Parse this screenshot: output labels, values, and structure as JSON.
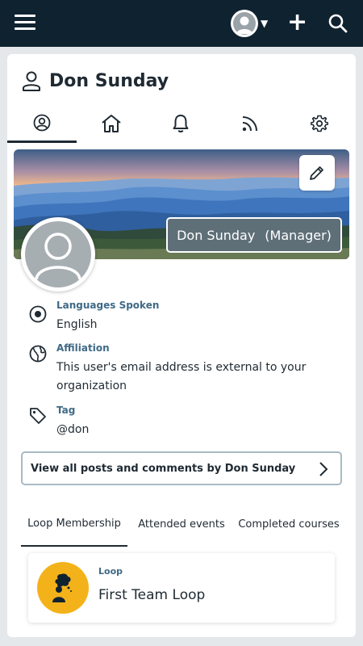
{
  "user": {
    "name": "Don Sunday",
    "role": "(Manager)"
  },
  "tabs": [
    {
      "icon": "user-circle-icon",
      "active": true
    },
    {
      "icon": "home-icon",
      "active": false
    },
    {
      "icon": "bell-icon",
      "active": false
    },
    {
      "icon": "rss-icon",
      "active": false
    },
    {
      "icon": "gear-icon",
      "active": false
    }
  ],
  "info": {
    "languages": {
      "label": "Languages Spoken",
      "value": "English",
      "icon": "radio-target-icon"
    },
    "affiliation": {
      "label": "Affiliation",
      "value": "This user's email address is external to your organization",
      "icon": "globe-icon"
    },
    "tag": {
      "label": "Tag",
      "value": "@don",
      "icon": "tag-icon"
    }
  },
  "view_all_label": "View all posts and comments by Don Sunday",
  "subtabs": [
    {
      "label": "Loop Membership",
      "active": true
    },
    {
      "label": "Attended events",
      "active": false
    },
    {
      "label": "Completed courses",
      "active": false
    }
  ],
  "loop": {
    "type": "Loop",
    "name": "First Team Loop"
  },
  "colors": {
    "topbar": "#0f2230",
    "accent_label": "#3f6a86",
    "loop_avatar": "#f4b21a",
    "badge_bg": "#5e6f78"
  }
}
